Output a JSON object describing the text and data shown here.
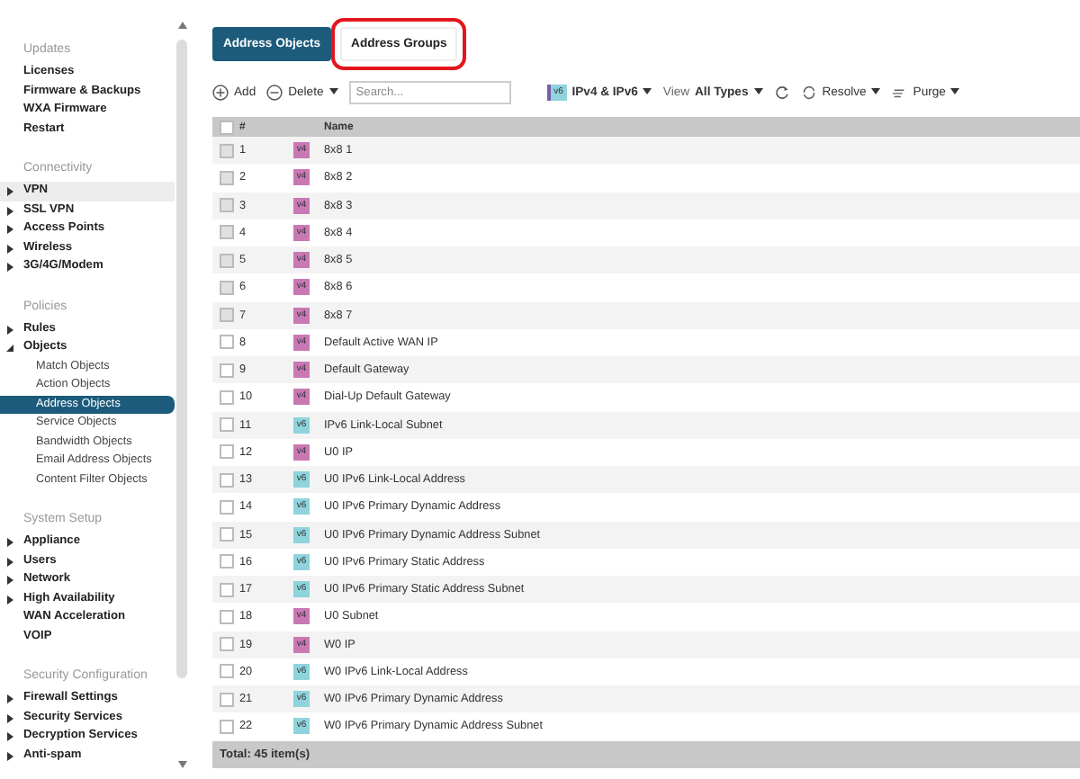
{
  "sidebar": {
    "sections": [
      {
        "title": "Updates",
        "items": [
          {
            "label": "Licenses"
          },
          {
            "label": "Firmware & Backups"
          },
          {
            "label": "WXA Firmware"
          },
          {
            "label": "Restart"
          }
        ]
      },
      {
        "title": "Connectivity",
        "items": [
          {
            "label": "VPN",
            "expanded": false,
            "hovered": true
          },
          {
            "label": "SSL VPN",
            "expanded": false
          },
          {
            "label": "Access Points",
            "expanded": false
          },
          {
            "label": "Wireless",
            "expanded": false
          },
          {
            "label": "3G/4G/Modem",
            "expanded": false
          }
        ]
      },
      {
        "title": "Policies",
        "items": [
          {
            "label": "Rules",
            "expanded": false
          },
          {
            "label": "Objects",
            "expanded": true,
            "children": [
              {
                "label": "Match Objects",
                "selected": false
              },
              {
                "label": "Action Objects",
                "selected": false
              },
              {
                "label": "Address Objects",
                "selected": true
              },
              {
                "label": "Service Objects",
                "selected": false
              },
              {
                "label": "Bandwidth Objects",
                "selected": false
              },
              {
                "label": "Email Address Objects",
                "selected": false
              },
              {
                "label": "Content Filter Objects",
                "selected": false
              }
            ]
          }
        ]
      },
      {
        "title": "System Setup",
        "items": [
          {
            "label": "Appliance",
            "expanded": false
          },
          {
            "label": "Users",
            "expanded": false
          },
          {
            "label": "Network",
            "expanded": false
          },
          {
            "label": "High Availability",
            "expanded": false
          },
          {
            "label": "WAN Acceleration"
          },
          {
            "label": "VOIP"
          }
        ]
      },
      {
        "title": "Security Configuration",
        "items": [
          {
            "label": "Firewall Settings",
            "expanded": false
          },
          {
            "label": "Security Services",
            "expanded": false
          },
          {
            "label": "Decryption Services",
            "expanded": false
          },
          {
            "label": "Anti-spam",
            "expanded": false
          }
        ]
      }
    ]
  },
  "tabs": [
    {
      "label": "Address Objects",
      "selected": true,
      "annotated": false
    },
    {
      "label": "Address Groups",
      "selected": false,
      "annotated": true
    }
  ],
  "toolbar": {
    "add": "Add",
    "delete": "Delete",
    "search": {
      "placeholder": "Search..."
    },
    "ip_badge": "v6",
    "ip_filter": "IPv4 & IPv6",
    "view_label": "View",
    "view_value": "All Types",
    "resolve": "Resolve",
    "purge": "Purge"
  },
  "table": {
    "columns": [
      "#",
      "Name"
    ],
    "header_checked": false,
    "rows": [
      {
        "num": "1",
        "badge": "v4",
        "kind": "ipv4",
        "name": "8x8 1",
        "checked": false,
        "disabled": true
      },
      {
        "num": "2",
        "badge": "v4",
        "kind": "ipv4",
        "name": "8x8 2",
        "checked": false,
        "disabled": true
      },
      {
        "num": "3",
        "badge": "v4",
        "kind": "ipv4",
        "name": "8x8 3",
        "checked": false,
        "disabled": true
      },
      {
        "num": "4",
        "badge": "v4",
        "kind": "ipv4",
        "name": "8x8 4",
        "checked": false,
        "disabled": true
      },
      {
        "num": "5",
        "badge": "v4",
        "kind": "ipv4",
        "name": "8x8 5",
        "checked": false,
        "disabled": true
      },
      {
        "num": "6",
        "badge": "v4",
        "kind": "ipv4",
        "name": "8x8 6",
        "checked": false,
        "disabled": true
      },
      {
        "num": "7",
        "badge": "v4",
        "kind": "ipv4",
        "name": "8x8 7",
        "checked": false,
        "disabled": true
      },
      {
        "num": "8",
        "badge": "v4",
        "kind": "ipv4",
        "name": "Default Active WAN IP",
        "checked": false,
        "disabled": false
      },
      {
        "num": "9",
        "badge": "v4",
        "kind": "ipv4",
        "name": "Default Gateway",
        "checked": false,
        "disabled": false
      },
      {
        "num": "10",
        "badge": "v4",
        "kind": "ipv4",
        "name": "Dial-Up Default Gateway",
        "checked": false,
        "disabled": false
      },
      {
        "num": "11",
        "badge": "v6",
        "kind": "ipv6",
        "name": "IPv6 Link-Local Subnet",
        "checked": false,
        "disabled": false
      },
      {
        "num": "12",
        "badge": "v4",
        "kind": "ipv4",
        "name": "U0 IP",
        "checked": false,
        "disabled": false
      },
      {
        "num": "13",
        "badge": "v6",
        "kind": "ipv6",
        "name": "U0 IPv6 Link-Local Address",
        "checked": false,
        "disabled": false
      },
      {
        "num": "14",
        "badge": "v6",
        "kind": "ipv6",
        "name": "U0 IPv6 Primary Dynamic Address",
        "checked": false,
        "disabled": false
      },
      {
        "num": "15",
        "badge": "v6",
        "kind": "ipv6",
        "name": "U0 IPv6 Primary Dynamic Address Subnet",
        "checked": false,
        "disabled": false
      },
      {
        "num": "16",
        "badge": "v6",
        "kind": "ipv6",
        "name": "U0 IPv6 Primary Static Address",
        "checked": false,
        "disabled": false
      },
      {
        "num": "17",
        "badge": "v6",
        "kind": "ipv6",
        "name": "U0 IPv6 Primary Static Address Subnet",
        "checked": false,
        "disabled": false
      },
      {
        "num": "18",
        "badge": "v4",
        "kind": "ipv4",
        "name": "U0 Subnet",
        "checked": false,
        "disabled": false
      },
      {
        "num": "19",
        "badge": "v4",
        "kind": "ipv4",
        "name": "W0 IP",
        "checked": false,
        "disabled": false
      },
      {
        "num": "20",
        "badge": "v6",
        "kind": "ipv6",
        "name": "W0 IPv6 Link-Local Address",
        "checked": false,
        "disabled": false
      },
      {
        "num": "21",
        "badge": "v6",
        "kind": "ipv6",
        "name": "W0 IPv6 Primary Dynamic Address",
        "checked": false,
        "disabled": false
      },
      {
        "num": "22",
        "badge": "v6",
        "kind": "ipv6",
        "name": "W0 IPv6 Primary Dynamic Address Subnet",
        "checked": false,
        "disabled": false
      }
    ]
  },
  "status_bar": "Total: 45 item(s)"
}
